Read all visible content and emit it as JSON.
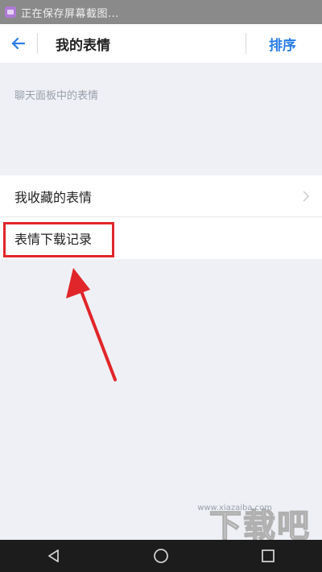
{
  "status_bar": {
    "text": "正在保存屏幕截图...",
    "icon": "screenshot-icon"
  },
  "header": {
    "back_icon": "back-arrow-icon",
    "title": "我的表情",
    "sort_label": "排序"
  },
  "section": {
    "label": "聊天面板中的表情"
  },
  "list": {
    "items": [
      {
        "label": "我收藏的表情",
        "chevron": true
      },
      {
        "label": "表情下载记录",
        "chevron": false,
        "highlighted": true
      }
    ]
  },
  "annotation": {
    "arrow_color": "#e0262a",
    "box_color": "#e0262a"
  },
  "nav_bar": {
    "back_icon": "triangle-back-icon",
    "home_icon": "circle-home-icon",
    "recents_icon": "square-recents-icon"
  },
  "watermark": {
    "logo_text": "下载吧",
    "url": "www.xiazaiba.com"
  },
  "colors": {
    "accent": "#2a7de8",
    "background": "#eef0f5",
    "highlight": "#e0262a"
  }
}
